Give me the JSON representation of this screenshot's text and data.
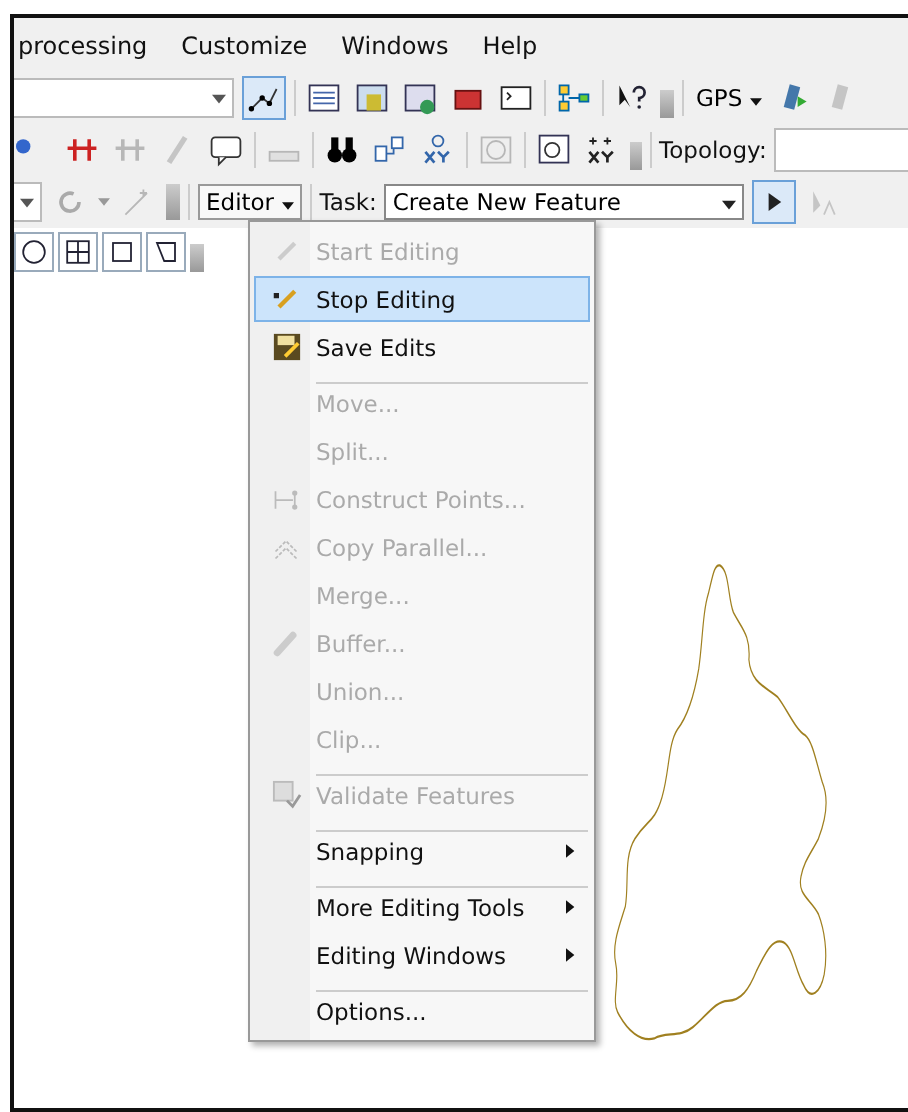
{
  "menu_bar": [
    "processing",
    "Customize",
    "Windows",
    "Help"
  ],
  "toolbar": {
    "gps_label": "GPS",
    "topology_label": "Topology:",
    "editor_label": "Editor",
    "task_label": "Task:",
    "task_value": "Create New Feature"
  },
  "editor_menu": [
    {
      "label": "Start Editing",
      "disabled": true,
      "selected": false,
      "submenu": false,
      "separator_before": false
    },
    {
      "label": "Stop Editing",
      "disabled": false,
      "selected": true,
      "submenu": false,
      "separator_before": false
    },
    {
      "label": "Save Edits",
      "disabled": false,
      "selected": false,
      "submenu": false,
      "separator_before": false
    },
    {
      "label": "Move...",
      "disabled": true,
      "selected": false,
      "submenu": false,
      "separator_before": true
    },
    {
      "label": "Split...",
      "disabled": true,
      "selected": false,
      "submenu": false,
      "separator_before": false
    },
    {
      "label": "Construct Points...",
      "disabled": true,
      "selected": false,
      "submenu": false,
      "separator_before": false
    },
    {
      "label": "Copy Parallel...",
      "disabled": true,
      "selected": false,
      "submenu": false,
      "separator_before": false
    },
    {
      "label": "Merge...",
      "disabled": true,
      "selected": false,
      "submenu": false,
      "separator_before": false
    },
    {
      "label": "Buffer...",
      "disabled": true,
      "selected": false,
      "submenu": false,
      "separator_before": false
    },
    {
      "label": "Union...",
      "disabled": true,
      "selected": false,
      "submenu": false,
      "separator_before": false
    },
    {
      "label": "Clip...",
      "disabled": true,
      "selected": false,
      "submenu": false,
      "separator_before": false
    },
    {
      "label": "Validate Features",
      "disabled": true,
      "selected": false,
      "submenu": false,
      "separator_before": true
    },
    {
      "label": "Snapping",
      "disabled": false,
      "selected": false,
      "submenu": true,
      "separator_before": true
    },
    {
      "label": "More Editing Tools",
      "disabled": false,
      "selected": false,
      "submenu": true,
      "separator_before": true
    },
    {
      "label": "Editing Windows",
      "disabled": false,
      "selected": false,
      "submenu": true,
      "separator_before": false
    },
    {
      "label": "Options...",
      "disabled": false,
      "selected": false,
      "submenu": false,
      "separator_before": true
    }
  ]
}
